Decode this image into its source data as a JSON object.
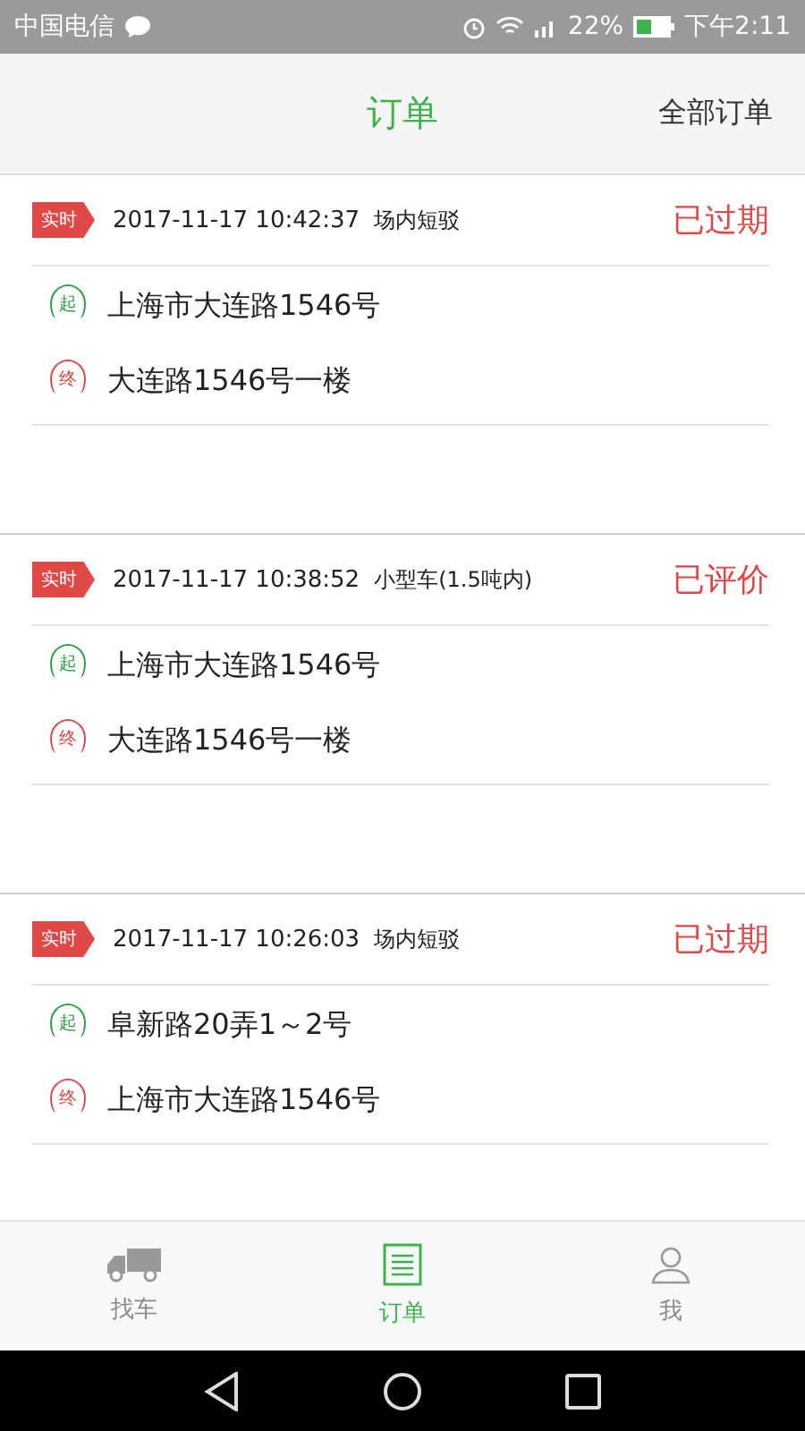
{
  "status_bar": {
    "carrier": "中国电信",
    "battery": "22%",
    "time": "下午2:11"
  },
  "header": {
    "title": "订单",
    "action": "全部订单"
  },
  "orders": [
    {
      "tag": "实时",
      "datetime": "2017-11-17 10:42:37",
      "service": "场内短驳",
      "status": "已过期",
      "from_badge": "起",
      "from": "上海市大连路1546号",
      "to_badge": "终",
      "to": "大连路1546号一楼"
    },
    {
      "tag": "实时",
      "datetime": "2017-11-17 10:38:52",
      "service": "小型车(1.5吨内)",
      "status": "已评价",
      "from_badge": "起",
      "from": "上海市大连路1546号",
      "to_badge": "终",
      "to": "大连路1546号一楼"
    },
    {
      "tag": "实时",
      "datetime": "2017-11-17 10:26:03",
      "service": "场内短驳",
      "status": "已过期",
      "from_badge": "起",
      "from": "阜新路20弄1～2号",
      "to_badge": "终",
      "to": "上海市大连路1546号"
    }
  ],
  "tabs": [
    {
      "kind": "truck",
      "label": "找车",
      "selected": false
    },
    {
      "kind": "orders",
      "label": "订单",
      "selected": true
    },
    {
      "kind": "user",
      "label": "我",
      "selected": false
    }
  ]
}
